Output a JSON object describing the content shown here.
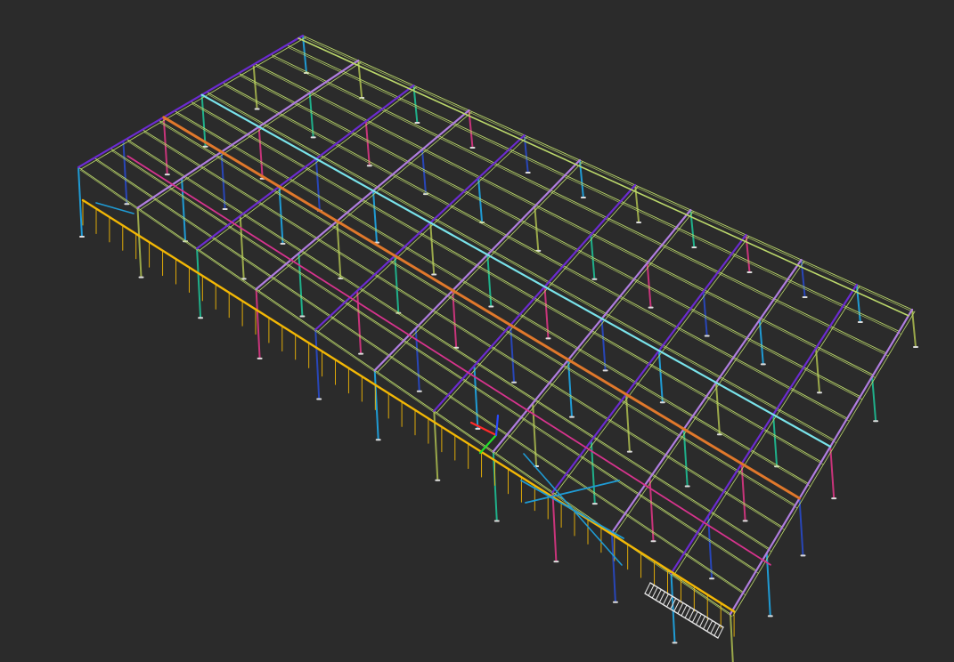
{
  "viewport": {
    "background": "#2b2b2b",
    "content": "3d-steel-frame-model"
  },
  "colors": {
    "eave_beam": "#f2b705",
    "ridge_beam": "#e0782b",
    "cyan_purlin": "#79e3ea",
    "magenta_line": "#d7338d",
    "purlin": "#bcd96b",
    "rafter": "#6b2ad0",
    "rafter_light": "#b07de0",
    "column_blue": "#1f9bd4",
    "column_teal": "#1fb08a",
    "column_olive": "#9aa84a",
    "column_pink": "#c8347a",
    "column_navy": "#2846b8",
    "brace": "#1f9bd4",
    "stair": "#e6e6e6",
    "axis_x": "#ff2a2a",
    "axis_y": "#22e02a",
    "axis_z": "#2a4bff"
  },
  "gizmo": {
    "icon": "axis-triad-icon"
  }
}
